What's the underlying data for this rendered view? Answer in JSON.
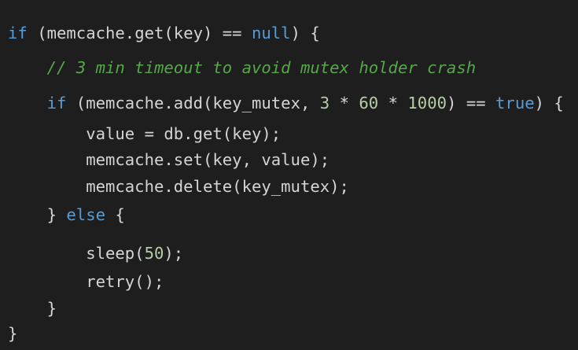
{
  "colors": {
    "background": "#1e1e1e",
    "text": "#d4d4d4",
    "keyword": "#569cd6",
    "number": "#b5cea8",
    "comment": "#57a64a"
  },
  "code": {
    "lines": [
      {
        "indent": 0,
        "tokens": [
          {
            "t": "kw",
            "v": "if"
          },
          {
            "t": "tx",
            "v": " (memcache.get(key) == "
          },
          {
            "t": "kw",
            "v": "null"
          },
          {
            "t": "tx",
            "v": ") {"
          }
        ]
      },
      {
        "indent": 1,
        "tokens": [
          {
            "t": "cm",
            "v": "// 3 min timeout to avoid mutex holder crash"
          }
        ]
      },
      {
        "indent": 1,
        "tokens": [
          {
            "t": "kw",
            "v": "if"
          },
          {
            "t": "tx",
            "v": " (memcache.add(key_mutex, "
          },
          {
            "t": "num",
            "v": "3"
          },
          {
            "t": "tx",
            "v": " * "
          },
          {
            "t": "num",
            "v": "60"
          },
          {
            "t": "tx",
            "v": " * "
          },
          {
            "t": "num",
            "v": "1000"
          },
          {
            "t": "tx",
            "v": ") == "
          },
          {
            "t": "kw",
            "v": "true"
          },
          {
            "t": "tx",
            "v": ") {"
          }
        ]
      },
      {
        "indent": 2,
        "tokens": [
          {
            "t": "tx",
            "v": "value = db.get(key);"
          }
        ]
      },
      {
        "indent": 2,
        "tokens": [
          {
            "t": "tx",
            "v": "memcache.set(key, value);"
          }
        ]
      },
      {
        "indent": 2,
        "tokens": [
          {
            "t": "tx",
            "v": "memcache.delete(key_mutex);"
          }
        ]
      },
      {
        "indent": 1,
        "tokens": [
          {
            "t": "tx",
            "v": "} "
          },
          {
            "t": "kw",
            "v": "else"
          },
          {
            "t": "tx",
            "v": " {"
          }
        ]
      },
      {
        "indent": 2,
        "tokens": [
          {
            "t": "tx",
            "v": "sleep("
          },
          {
            "t": "num",
            "v": "50"
          },
          {
            "t": "tx",
            "v": ");"
          }
        ]
      },
      {
        "indent": 2,
        "tokens": [
          {
            "t": "tx",
            "v": "retry();"
          }
        ]
      },
      {
        "indent": 1,
        "tokens": [
          {
            "t": "tx",
            "v": "}"
          }
        ]
      },
      {
        "indent": 0,
        "tokens": [
          {
            "t": "tx",
            "v": "}"
          }
        ]
      }
    ]
  }
}
